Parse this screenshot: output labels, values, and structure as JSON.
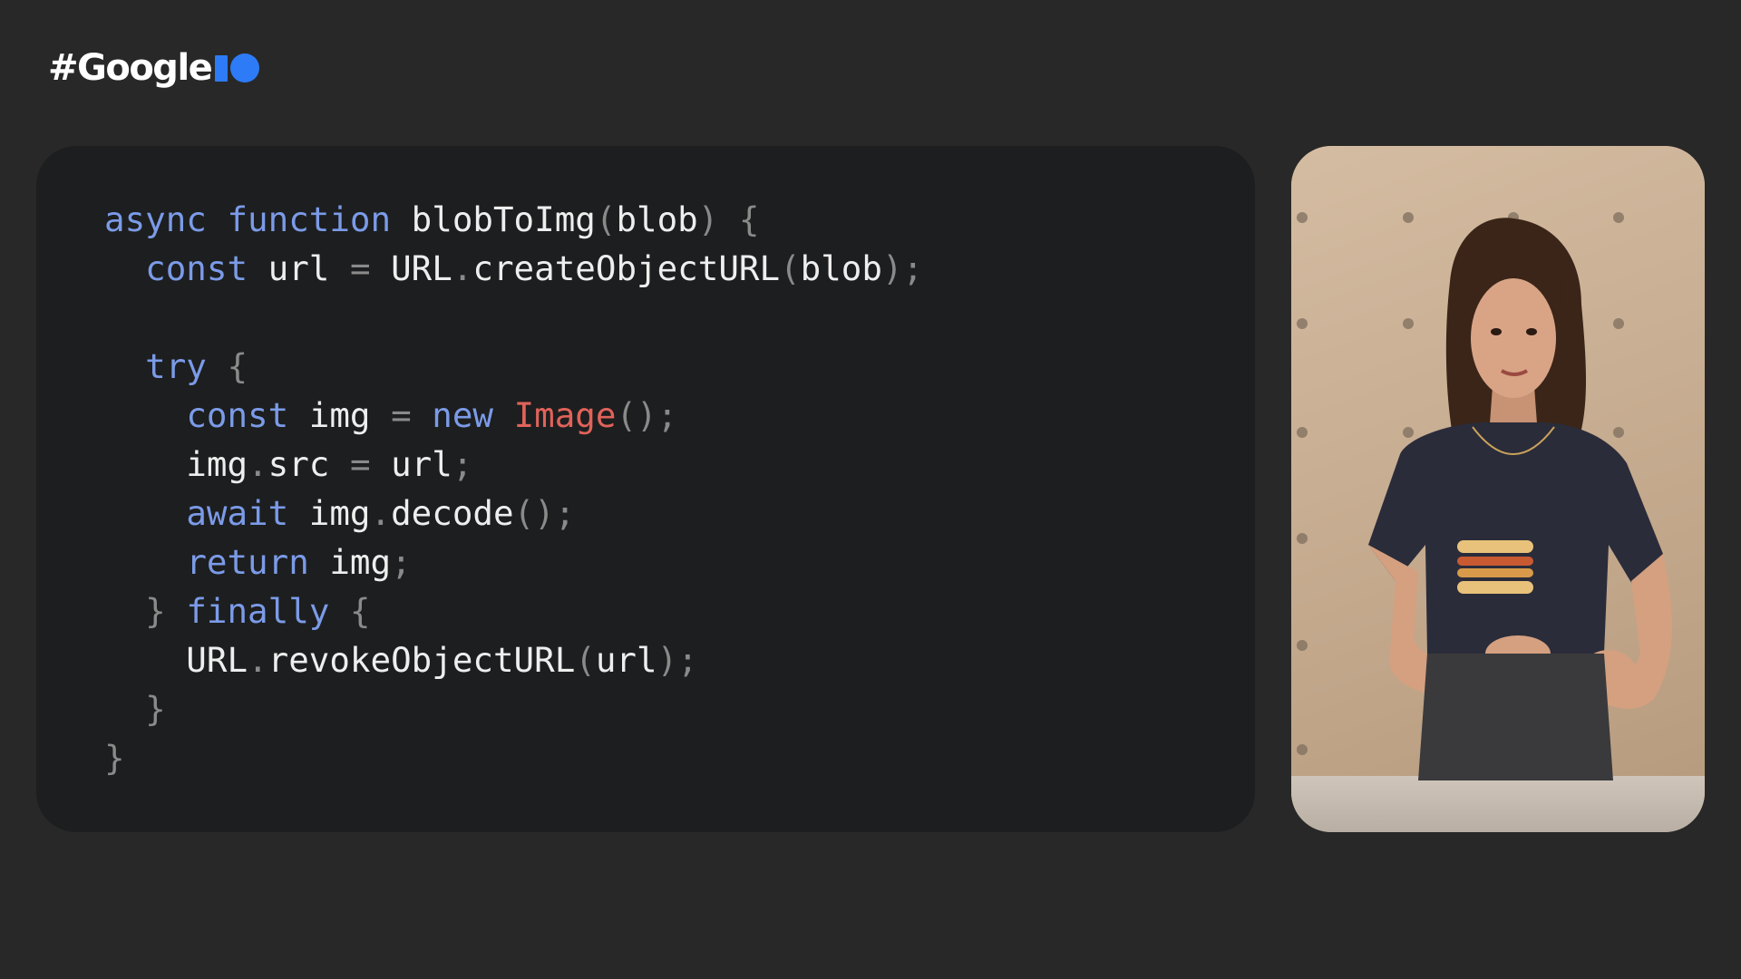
{
  "branding": {
    "logo_text": "#Google",
    "accent_color": "#2d7bf6"
  },
  "code": {
    "lines": [
      [
        {
          "t": "async",
          "c": "kw"
        },
        {
          "t": " ",
          "c": "id"
        },
        {
          "t": "function",
          "c": "kw"
        },
        {
          "t": " blobToImg",
          "c": "id"
        },
        {
          "t": "(",
          "c": "pn"
        },
        {
          "t": "blob",
          "c": "id"
        },
        {
          "t": ") {",
          "c": "pn"
        }
      ],
      [
        {
          "t": "  ",
          "c": "id"
        },
        {
          "t": "const",
          "c": "kw"
        },
        {
          "t": " url ",
          "c": "id"
        },
        {
          "t": "=",
          "c": "pn"
        },
        {
          "t": " URL",
          "c": "id"
        },
        {
          "t": ".",
          "c": "pn"
        },
        {
          "t": "createObjectURL",
          "c": "id"
        },
        {
          "t": "(",
          "c": "pn"
        },
        {
          "t": "blob",
          "c": "id"
        },
        {
          "t": ");",
          "c": "pn"
        }
      ],
      [],
      [
        {
          "t": "  ",
          "c": "id"
        },
        {
          "t": "try",
          "c": "kw"
        },
        {
          "t": " {",
          "c": "pn"
        }
      ],
      [
        {
          "t": "    ",
          "c": "id"
        },
        {
          "t": "const",
          "c": "kw"
        },
        {
          "t": " img ",
          "c": "id"
        },
        {
          "t": "=",
          "c": "pn"
        },
        {
          "t": " ",
          "c": "id"
        },
        {
          "t": "new",
          "c": "kw"
        },
        {
          "t": " ",
          "c": "id"
        },
        {
          "t": "Image",
          "c": "cls"
        },
        {
          "t": "();",
          "c": "pn"
        }
      ],
      [
        {
          "t": "    img",
          "c": "id"
        },
        {
          "t": ".",
          "c": "pn"
        },
        {
          "t": "src ",
          "c": "id"
        },
        {
          "t": "=",
          "c": "pn"
        },
        {
          "t": " url",
          "c": "id"
        },
        {
          "t": ";",
          "c": "pn"
        }
      ],
      [
        {
          "t": "    ",
          "c": "id"
        },
        {
          "t": "await",
          "c": "kw"
        },
        {
          "t": " img",
          "c": "id"
        },
        {
          "t": ".",
          "c": "pn"
        },
        {
          "t": "decode",
          "c": "id"
        },
        {
          "t": "();",
          "c": "pn"
        }
      ],
      [
        {
          "t": "    ",
          "c": "id"
        },
        {
          "t": "return",
          "c": "kw"
        },
        {
          "t": " img",
          "c": "id"
        },
        {
          "t": ";",
          "c": "pn"
        }
      ],
      [
        {
          "t": "  } ",
          "c": "pn"
        },
        {
          "t": "finally",
          "c": "kw"
        },
        {
          "t": " {",
          "c": "pn"
        }
      ],
      [
        {
          "t": "    URL",
          "c": "id"
        },
        {
          "t": ".",
          "c": "pn"
        },
        {
          "t": "revokeObjectURL",
          "c": "id"
        },
        {
          "t": "(",
          "c": "pn"
        },
        {
          "t": "url",
          "c": "id"
        },
        {
          "t": ");",
          "c": "pn"
        }
      ],
      [
        {
          "t": "  }",
          "c": "pn"
        }
      ],
      [
        {
          "t": "}",
          "c": "pn"
        }
      ]
    ],
    "colors": {
      "keyword": "#7b9be8",
      "class": "#e0635a",
      "punctuation": "#8a8a8a",
      "identifier": "#eeeeee"
    }
  },
  "video": {
    "icon": "presenter-video"
  }
}
